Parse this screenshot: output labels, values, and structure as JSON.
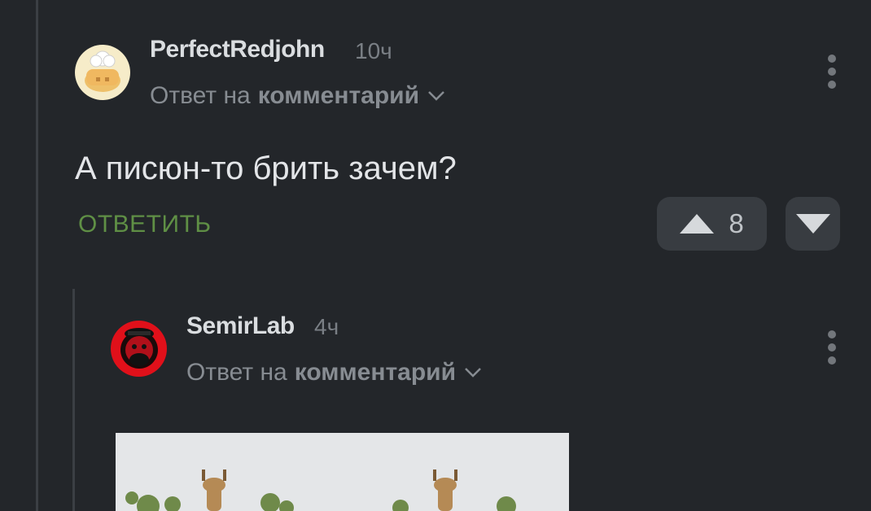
{
  "comments": [
    {
      "username": "PerfectRedjohn",
      "time": "10ч",
      "reply_prefix": "Ответ на",
      "reply_target": "комментарий",
      "text": "А писюн-то брить зачем?",
      "reply_label": "ОТВЕТИТЬ",
      "rating": "8"
    },
    {
      "username": "SemirLab",
      "time": "4ч",
      "reply_prefix": "Ответ на",
      "reply_target": "комментарий"
    }
  ],
  "colors": {
    "background": "#23262a",
    "reply_button": "#5f8f45",
    "vote_button": "#383c41"
  },
  "icons": [
    "chevron-down-icon",
    "more-vertical-icon",
    "upvote-icon",
    "downvote-icon"
  ]
}
